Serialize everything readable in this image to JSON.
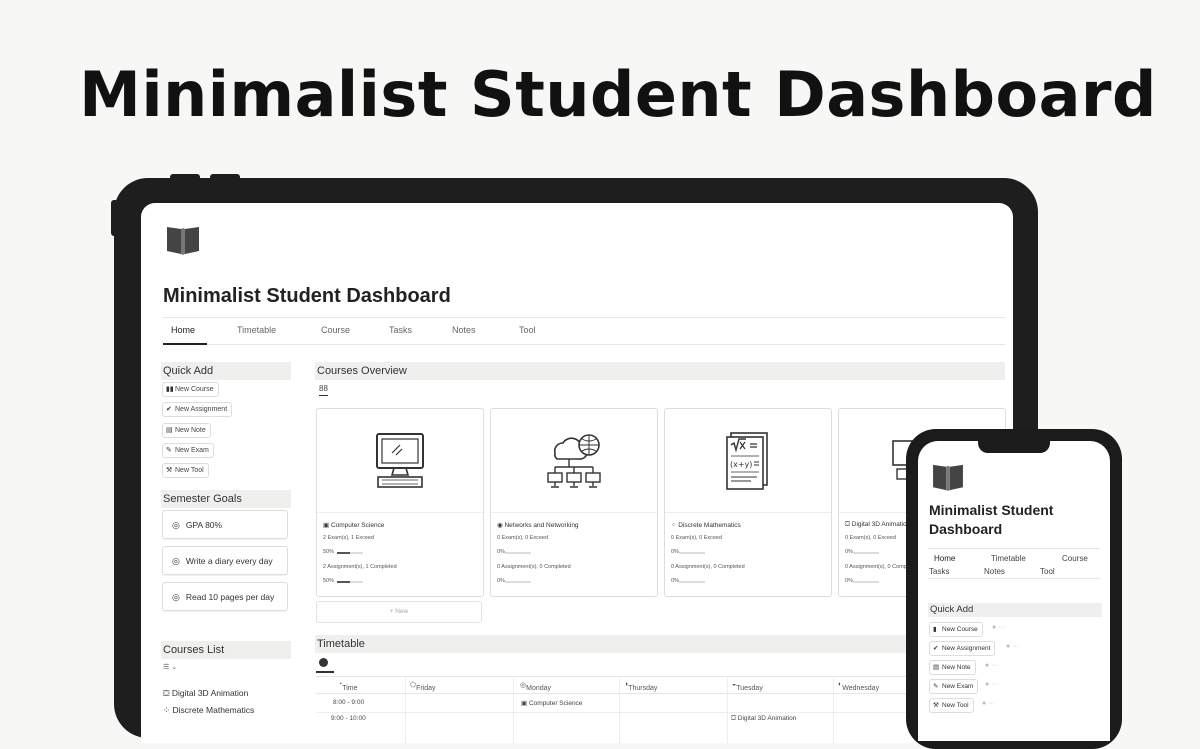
{
  "hero_title": "Minimalist Student Dashboard",
  "tablet": {
    "page_title": "Minimalist Student Dashboard",
    "nav_tabs": [
      "Home",
      "Timetable",
      "Course",
      "Tasks",
      "Notes",
      "Tool"
    ],
    "quick_add": {
      "heading": "Quick Add",
      "buttons": [
        {
          "icon": "book-icon",
          "label": "New Course"
        },
        {
          "icon": "check-circle-icon",
          "label": "New Assignment"
        },
        {
          "icon": "note-icon",
          "label": "New Note"
        },
        {
          "icon": "exam-icon",
          "label": "New Exam"
        },
        {
          "icon": "wrench-icon",
          "label": "New Tool"
        }
      ]
    },
    "semester_goals": {
      "heading": "Semester Goals",
      "items": [
        "GPA 80%",
        "Write a diary every day",
        "Read 10 pages per day"
      ]
    },
    "courses_list": {
      "heading": "Courses List",
      "view_glyph": "☰ ⌄",
      "items": [
        "Digital 3D Animation",
        "Discrete Mathematics"
      ]
    },
    "courses_overview": {
      "heading": "Courses Overview",
      "view_glyph": "88",
      "cards": [
        {
          "name": "Computer Science",
          "exams": "2 Exam(s), 1 Exceed",
          "exam_pct": "50%",
          "exam_progress": 0.5,
          "assignments": "2 Assignment(s), 1 Completed",
          "assign_pct": "50%",
          "assign_progress": 0.5,
          "image_icon": "computer-icon"
        },
        {
          "name": "Networks and Networking",
          "exams": "0 Exam(s), 0 Exceed",
          "exam_pct": "0%",
          "exam_progress": 0,
          "assignments": "0 Assignment(s), 0 Completed",
          "assign_pct": "0%",
          "assign_progress": 0,
          "image_icon": "network-icon"
        },
        {
          "name": "Discrete Mathematics",
          "exams": "0 Exam(s), 0 Exceed",
          "exam_pct": "0%",
          "exam_progress": 0,
          "assignments": "0 Assignment(s), 0 Completed",
          "assign_pct": "0%",
          "assign_progress": 0,
          "image_icon": "math-icon"
        },
        {
          "name": "Digital 3D Animation",
          "exams": "0 Exam(s), 0 Exceed",
          "exam_pct": "0%",
          "exam_progress": 0,
          "assignments": "0 Assignment(s), 0 Completed",
          "assign_pct": "0%",
          "assign_progress": 0,
          "image_icon": "animation-icon"
        }
      ],
      "new_label": "+ New"
    },
    "timetable": {
      "heading": "Timetable",
      "columns": [
        "Time",
        "Friday",
        "Monday",
        "Thursday",
        "Tuesday",
        "Wednesday"
      ],
      "rows": [
        {
          "time": "8:00 - 9:00",
          "Monday": "Computer Science"
        },
        {
          "time": "9:00 - 10:00",
          "Tuesday": "Digital 3D Animation"
        }
      ]
    }
  },
  "phone": {
    "page_title": "Minimalist Student Dashboard",
    "nav_row1": [
      "Home",
      "Timetable",
      "Course"
    ],
    "nav_row2": [
      "Tasks",
      "Notes",
      "Tool"
    ],
    "quick_add_heading": "Quick Add",
    "buttons": [
      "New Course",
      "New Assignment",
      "New Note",
      "New Exam",
      "New Tool"
    ]
  },
  "colors": {
    "frame": "#1e1e1e",
    "background": "#f7f7f6",
    "section_bg": "#efefee",
    "text": "#2b2b2b"
  }
}
